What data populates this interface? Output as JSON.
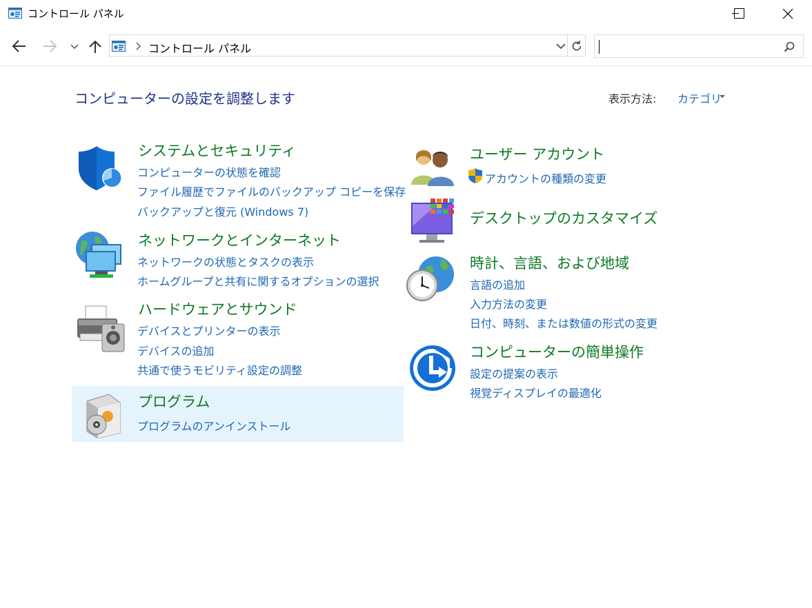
{
  "window": {
    "title": "コントロール パネル"
  },
  "address_bar": {
    "breadcrumb": "コントロール パネル",
    "search_placeholder": ""
  },
  "header": {
    "heading": "コンピューターの設定を調整します",
    "view_by_label": "表示方法:",
    "view_by_value": "カテゴリ"
  },
  "categories": {
    "system_security": {
      "title": "システムとセキュリティ",
      "links": [
        "コンピューターの状態を確認",
        "ファイル履歴でファイルのバックアップ コピーを保存",
        "バックアップと復元 (Windows 7)"
      ]
    },
    "network": {
      "title": "ネットワークとインターネット",
      "links": [
        "ネットワークの状態とタスクの表示",
        "ホームグループと共有に関するオプションの選択"
      ]
    },
    "hardware": {
      "title": "ハードウェアとサウンド",
      "links": [
        "デバイスとプリンターの表示",
        "デバイスの追加",
        "共通で使うモビリティ設定の調整"
      ]
    },
    "programs": {
      "title": "プログラム",
      "links": [
        "プログラムのアンインストール"
      ]
    },
    "user_accounts": {
      "title": "ユーザー アカウント",
      "links": [
        "アカウントの種類の変更"
      ]
    },
    "desktop": {
      "title": "デスクトップのカスタマイズ",
      "links": []
    },
    "clock_region": {
      "title": "時計、言語、および地域",
      "links": [
        "言語の追加",
        "入力方法の変更",
        "日付、時刻、または数値の形式の変更"
      ]
    },
    "ease_of_access": {
      "title": "コンピューターの簡単操作",
      "links": [
        "設定の提案の表示",
        "視覚ディスプレイの最適化"
      ]
    }
  },
  "colors": {
    "category_title": "#0d7a24",
    "link": "#1e68b4",
    "heading": "#1e3287",
    "hover_highlight": "#e5f3fd"
  },
  "icons": {
    "titlebar": "control-panel-icon",
    "back": "back-arrow-icon",
    "forward": "forward-arrow-icon",
    "recent": "chevron-down-icon",
    "up": "up-arrow-icon",
    "refresh": "refresh-icon",
    "search": "search-icon",
    "minimize": "minimize-icon",
    "maximize": "maximize-icon",
    "close": "close-icon"
  }
}
